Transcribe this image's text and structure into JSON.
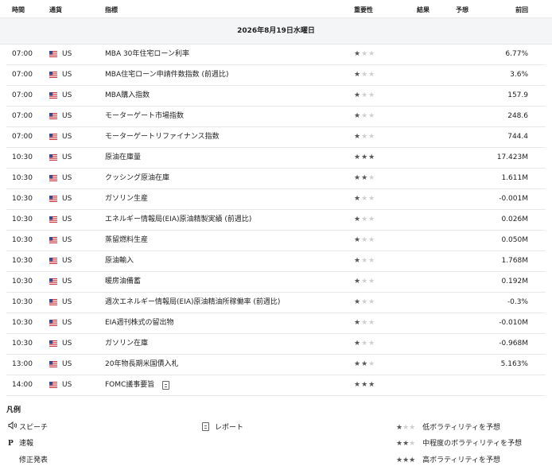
{
  "header": {
    "time": "時間",
    "currency": "通貨",
    "indicator": "指標",
    "importance": "重要性",
    "actual": "結果",
    "forecast": "予想",
    "previous": "前回"
  },
  "date_label": "2026年8月19日水曜日",
  "rows": [
    {
      "time": "07:00",
      "currency": "US",
      "indicator": "MBA 30年住宅ローン利率",
      "stars": 1,
      "previous": "6.77%"
    },
    {
      "time": "07:00",
      "currency": "US",
      "indicator": "MBA住宅ローン申請件数指数 (前週比)",
      "stars": 1,
      "previous": "3.6%"
    },
    {
      "time": "07:00",
      "currency": "US",
      "indicator": "MBA購入指数",
      "stars": 1,
      "previous": "157.9"
    },
    {
      "time": "07:00",
      "currency": "US",
      "indicator": "モーターゲート市場指数",
      "stars": 1,
      "previous": "248.6"
    },
    {
      "time": "07:00",
      "currency": "US",
      "indicator": "モーターゲートリファイナンス指数",
      "stars": 1,
      "previous": "744.4"
    },
    {
      "time": "10:30",
      "currency": "US",
      "indicator": "原油在庫量",
      "stars": 3,
      "previous": "17.423M"
    },
    {
      "time": "10:30",
      "currency": "US",
      "indicator": "クッシング原油在庫",
      "stars": 2,
      "previous": "1.611M"
    },
    {
      "time": "10:30",
      "currency": "US",
      "indicator": "ガソリン生産",
      "stars": 1,
      "previous": "-0.001M"
    },
    {
      "time": "10:30",
      "currency": "US",
      "indicator": "エネルギー情報局(EIA)原油精製実績 (前週比)",
      "stars": 1,
      "previous": "0.026M"
    },
    {
      "time": "10:30",
      "currency": "US",
      "indicator": "蒸留燃料生産",
      "stars": 1,
      "previous": "0.050M"
    },
    {
      "time": "10:30",
      "currency": "US",
      "indicator": "原油輸入",
      "stars": 1,
      "previous": "1.768M"
    },
    {
      "time": "10:30",
      "currency": "US",
      "indicator": "暖房油備蓄",
      "stars": 1,
      "previous": "0.192M"
    },
    {
      "time": "10:30",
      "currency": "US",
      "indicator": "週次エネルギー情報局(EIA)原油精油所稼働率 (前週比)",
      "stars": 1,
      "previous": "-0.3%"
    },
    {
      "time": "10:30",
      "currency": "US",
      "indicator": "EIA週刊株式の留出物",
      "stars": 1,
      "previous": "-0.010M"
    },
    {
      "time": "10:30",
      "currency": "US",
      "indicator": "ガソリン在庫",
      "stars": 1,
      "previous": "-0.968M"
    },
    {
      "time": "13:00",
      "currency": "US",
      "indicator": "20年物長期米国債入札",
      "stars": 2,
      "previous": "5.163%"
    },
    {
      "time": "14:00",
      "currency": "US",
      "indicator": "FOMC議事要旨",
      "stars": 3,
      "previous": "",
      "report_icon": true
    }
  ],
  "legend": {
    "title": "凡例",
    "speech": "スピーチ",
    "preliminary_icon": "P",
    "preliminary": "速報",
    "revised": "修正発表",
    "report": "レポート",
    "low": "低ボラティリティを予想",
    "mid": "中程度のボラティリティを予想",
    "high": "高ボラティリティを予想"
  },
  "colors": {
    "star_on": "#555555",
    "star_off": "#cfcfcf",
    "date_bar_bg": "#f4f5f7",
    "border": "#e8e8e8"
  },
  "icons": {
    "flag": "us-flag-icon",
    "report": "report-icon",
    "speech": "speaker-icon"
  }
}
